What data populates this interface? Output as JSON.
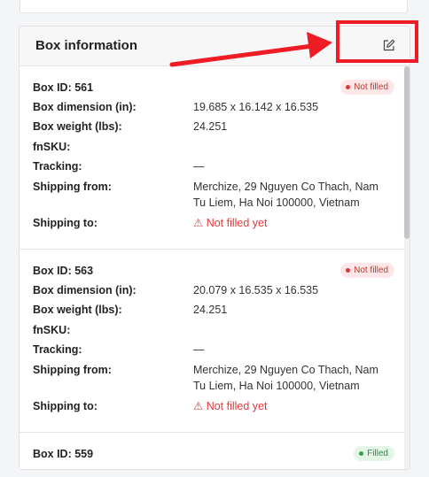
{
  "panel": {
    "title": "Box information",
    "edit_icon": "edit-icon"
  },
  "labels": {
    "box_id": "Box ID:",
    "dimension": "Box dimension (in):",
    "weight": "Box weight (lbs):",
    "fnsku": "fnSKU:",
    "tracking": "Tracking:",
    "shipping_from": "Shipping from:",
    "shipping_to": "Shipping to:"
  },
  "boxes": [
    {
      "id": "561",
      "status": "Not filled",
      "dimension": "19.685 x 16.142 x 16.535",
      "weight": "24.251",
      "fnsku": "",
      "tracking": "—",
      "shipping_from_1": "Merchize, 29 Nguyen Co Thach, Nam",
      "shipping_from_2": "Tu Liem, Ha Noi 100000, Vietnam",
      "shipping_to": "Not filled yet"
    },
    {
      "id": "563",
      "status": "Not filled",
      "dimension": "20.079 x 16.535 x 16.535",
      "weight": "24.251",
      "fnsku": "",
      "tracking": "—",
      "shipping_from_1": "Merchize, 29 Nguyen Co Thach, Nam",
      "shipping_from_2": "Tu Liem, Ha Noi 100000, Vietnam",
      "shipping_to": "Not filled yet"
    },
    {
      "id": "559",
      "status": "Filled"
    }
  ],
  "colors": {
    "annotation_red": "#ee1c24",
    "warning_red": "#e23b3b"
  }
}
